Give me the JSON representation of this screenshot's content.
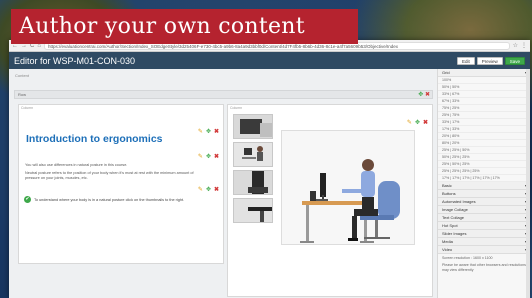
{
  "banner": {
    "title": "Author your own content"
  },
  "browser": {
    "url": "https://evaluationcentrai.com/Author/Section/Index_SOEdgeStyle/3d25406F-e730-4bc5-a9b6-8a4a9d3bbf0d/Content/4d7F4fb5-8b6b-4d36-8c1e-a4f7a5609b53/Objective/Index",
    "nav_back": "←",
    "nav_forward": "→",
    "nav_reload": "C",
    "nav_home": "⌂",
    "star_icon": "☆",
    "menu_icon": "⋮"
  },
  "app": {
    "editor_title": "Editor for WSP-M01-CON-030",
    "buttons": {
      "edit": "Edit",
      "preview": "Preview",
      "save": "Save"
    }
  },
  "workarea": {
    "breadcrumb": "Content",
    "row_label": "Row",
    "left_panel_tag": "Column",
    "right_panel_tag": "Column",
    "heading": "Introduction to ergonomics",
    "para1": "You will also use differences in natural posture in this course.",
    "para2": "Neutral posture refers to the position of your body when it's most at rest with the minimum amount of pressure on your joints, muscles, etc.",
    "bullet": "To understand where your body is in a natural posture click on the thumbnails to the right."
  },
  "sidebar": {
    "grid_header": "Grid",
    "grid_options": [
      "100%",
      "50% | 50%",
      "33% | 67%",
      "67% | 33%",
      "75% | 25%",
      "25% | 75%",
      "33% | 17%",
      "17% | 33%",
      "20% | 80%",
      "80% | 20%",
      "25% | 25% | 50%",
      "50% | 25% | 25%",
      "25% | 50% | 25%",
      "25% | 25% | 25% | 25%",
      "17% | 17% | 17% | 17% | 17% | 17%"
    ],
    "sections": [
      "Basic",
      "Buttons",
      "Automated Images",
      "Image Collage",
      "Text Collage",
      "Hot Spot",
      "Slider Images",
      "Media",
      "Video"
    ],
    "note_line1": "Screen resolution : 1600 x 1100",
    "note_line2": "Please be aware that other browsers and resolutions may view differently"
  },
  "icons": {
    "edit": "✎",
    "move": "✥",
    "close": "✖",
    "expand": "▾",
    "check": "✔"
  },
  "colors": {
    "banner": "#b5232f",
    "topbar": "#2f4a63",
    "heading": "#1d6fb8",
    "save": "#3ea84a",
    "close": "#d23a3a",
    "edit": "#e0a11b"
  }
}
